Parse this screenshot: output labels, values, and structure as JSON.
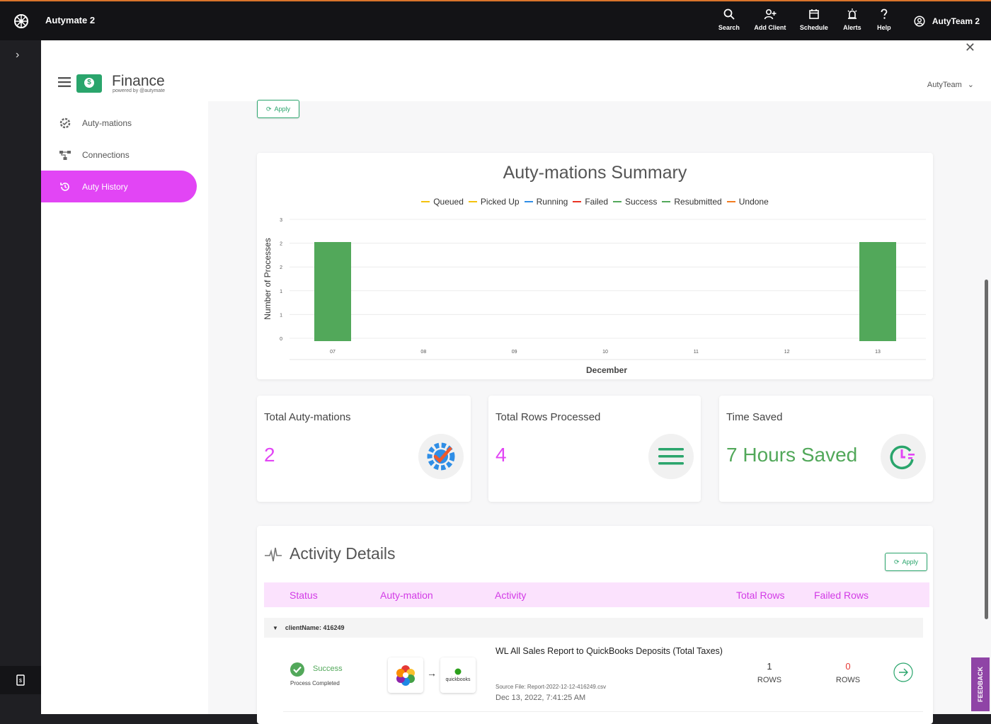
{
  "topbar": {
    "app_title": "Autymate 2",
    "nav": [
      {
        "label": "Search",
        "icon": "search-icon"
      },
      {
        "label": "Add Client",
        "icon": "add-user-icon"
      },
      {
        "label": "Schedule",
        "icon": "calendar-icon"
      },
      {
        "label": "Alerts",
        "icon": "alarm-icon"
      },
      {
        "label": "Help",
        "icon": "help-icon"
      }
    ],
    "profile": "AutyTeam 2"
  },
  "header": {
    "brand_title": "Finance",
    "brand_sub": "powered by @autymate",
    "team_select": "AutyTeam"
  },
  "sidebar": {
    "items": [
      {
        "label": "Auty-mations",
        "icon": "gear-check-icon",
        "active": false
      },
      {
        "label": "Connections",
        "icon": "network-icon",
        "active": false
      },
      {
        "label": "Auty History",
        "icon": "history-icon",
        "active": true
      }
    ]
  },
  "filters": {
    "apply_label": "Apply"
  },
  "summary": {
    "title": "Auty-mations Summary",
    "legend": [
      {
        "name": "Queued",
        "color": "#f4c20d"
      },
      {
        "name": "Picked Up",
        "color": "#f4c20d"
      },
      {
        "name": "Running",
        "color": "#2f8ee6"
      },
      {
        "name": "Failed",
        "color": "#ea3323"
      },
      {
        "name": "Success",
        "color": "#52a85a"
      },
      {
        "name": "Resubmitted",
        "color": "#52a85a"
      },
      {
        "name": "Undone",
        "color": "#f37c20"
      }
    ]
  },
  "chart_data": {
    "type": "bar",
    "title": "Auty-mations Summary",
    "xlabel": "December",
    "ylabel": "Number of Processes",
    "categories": [
      "07",
      "08",
      "09",
      "10",
      "11",
      "12",
      "13"
    ],
    "y_tick_labels": [
      "0",
      "1",
      "1",
      "2",
      "2",
      "3"
    ],
    "ylim": [
      0,
      2.5
    ],
    "series": [
      {
        "name": "Success",
        "color": "#52a85a",
        "values": [
          2,
          0,
          0,
          0,
          0,
          0,
          2
        ]
      }
    ],
    "grid": true,
    "legend": "top"
  },
  "stats": [
    {
      "label": "Total Auty-mations",
      "value": "2",
      "color": "#e245f5"
    },
    {
      "label": "Total Rows Processed",
      "value": "4",
      "color": "#e245f5"
    },
    {
      "label": "Time Saved",
      "value": "7 Hours Saved",
      "color": "#52a85a"
    }
  ],
  "activity": {
    "title": "Activity Details",
    "apply_label": "Apply",
    "columns": [
      "Status",
      "Auty-mation",
      "Activity",
      "Total Rows",
      "Failed Rows"
    ],
    "group_label": "clientName: 416249",
    "rows": [
      {
        "status": "Success",
        "status_sub": "Process Completed",
        "connector_to": "quickbooks",
        "activity_title": "WL All Sales Report to QuickBooks Deposits (Total Taxes)",
        "source_file": "Source File: Report-2022-12-12-416249.csv",
        "timestamp": "Dec 13, 2022, 7:41:25 AM",
        "total_rows": "1",
        "total_rows_unit": "ROWS",
        "failed_rows": "0",
        "failed_rows_unit": "ROWS"
      }
    ]
  },
  "feedback_label": "FEEDBACK"
}
